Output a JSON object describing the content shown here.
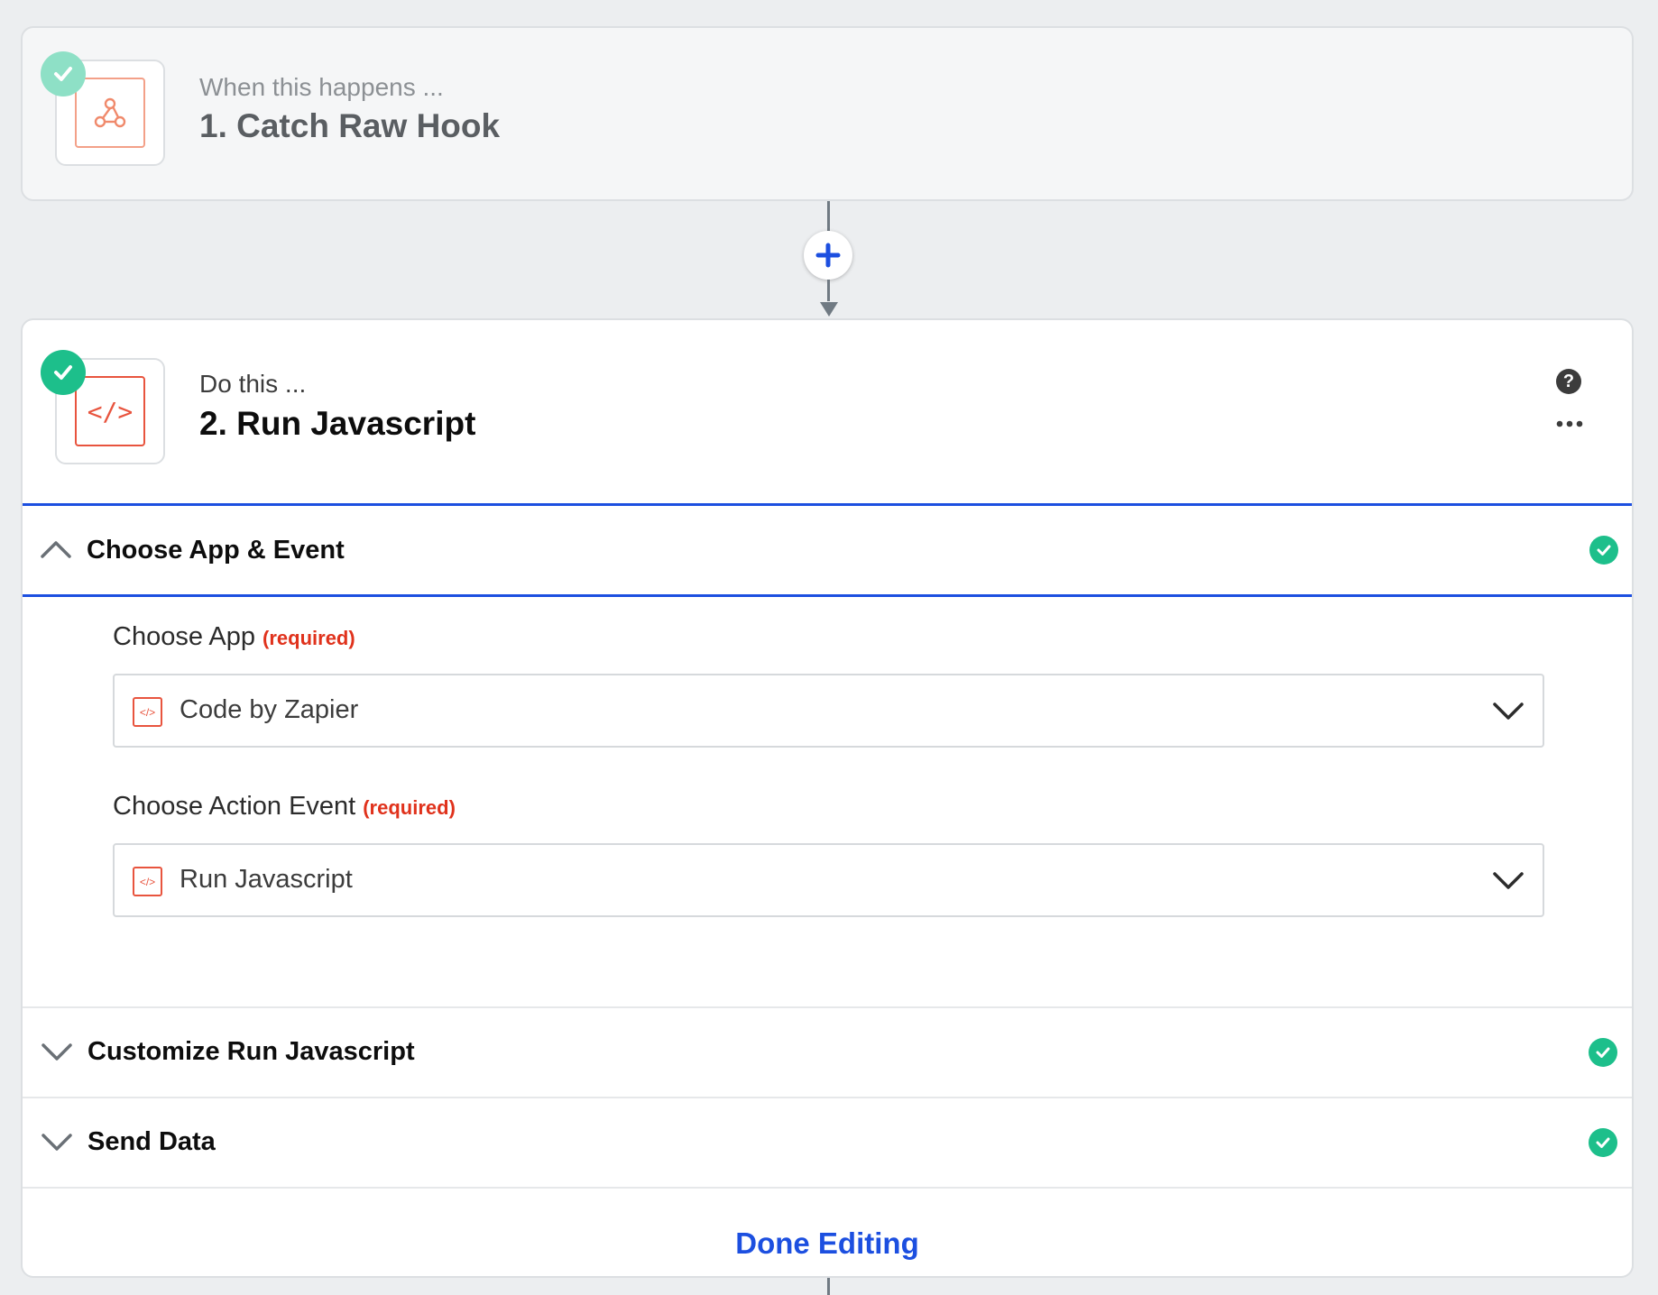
{
  "trigger": {
    "subtitle": "When this happens ...",
    "title": "1. Catch Raw Hook",
    "app_icon": "webhook-icon"
  },
  "connector": {
    "add_icon": "plus-icon"
  },
  "action": {
    "subtitle": "Do this ...",
    "title": "2. Run Javascript",
    "app_icon": "code-icon",
    "help_icon": "question-icon",
    "more_icon": "more-dots-icon"
  },
  "sections": {
    "choose_app_event": {
      "label": "Choose App & Event",
      "fields": {
        "app": {
          "label": "Choose App",
          "required": "(required)",
          "value": "Code by Zapier"
        },
        "event": {
          "label": "Choose Action Event",
          "required": "(required)",
          "value": "Run Javascript"
        }
      }
    },
    "customize": {
      "label": "Customize Run Javascript"
    },
    "send_data": {
      "label": "Send Data"
    }
  },
  "footer": {
    "done_label": "Done Editing"
  },
  "colors": {
    "accent_blue": "#1c4fe0",
    "success_green": "#1dbf8b",
    "code_orange": "#e8543e",
    "required_red": "#e0321c"
  }
}
